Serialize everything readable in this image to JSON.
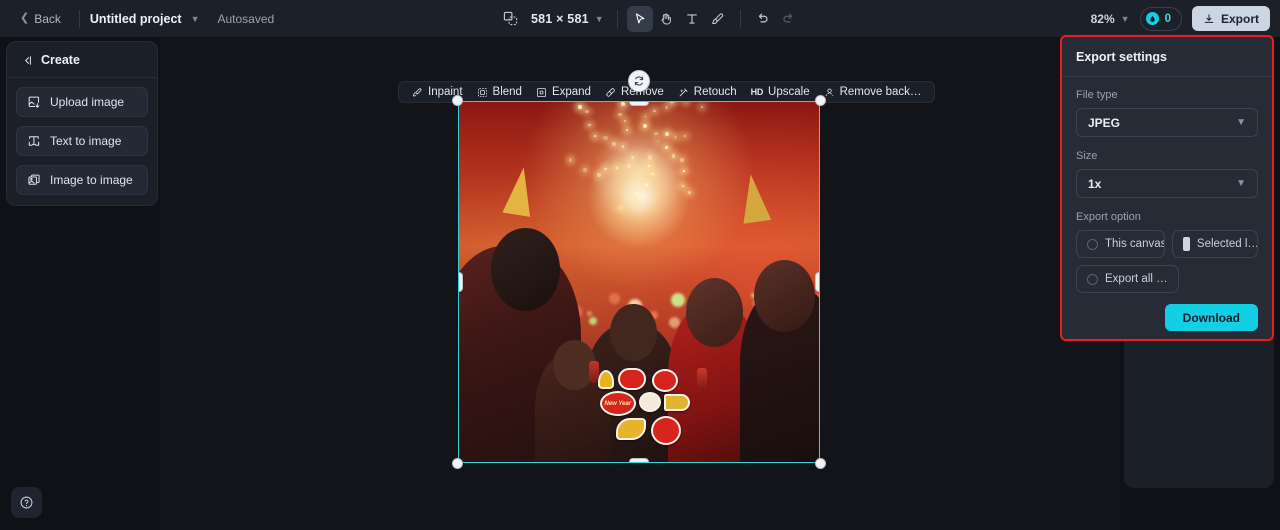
{
  "header": {
    "back_label": "Back",
    "project_name": "Untitled project",
    "autosave_status": "Autosaved",
    "canvas_size": "581 × 581",
    "zoom_level": "82%",
    "credits_count": "0",
    "export_label": "Export",
    "tools": [
      {
        "name": "canvas-size-icon",
        "label": ""
      },
      {
        "name": "select-tool",
        "label": "",
        "active": true
      },
      {
        "name": "hand-tool",
        "label": "",
        "active": false
      },
      {
        "name": "text-tool",
        "label": "",
        "active": false
      },
      {
        "name": "brush-tool",
        "label": "",
        "active": false
      },
      {
        "name": "undo",
        "label": "",
        "active": false
      },
      {
        "name": "redo",
        "label": "",
        "active": false
      }
    ]
  },
  "sidebar": {
    "title": "Create",
    "items": [
      {
        "label": "Upload image",
        "icon": "upload-image-icon"
      },
      {
        "label": "Text to image",
        "icon": "text-to-image-icon"
      },
      {
        "label": "Image to image",
        "icon": "image-to-image-icon"
      }
    ]
  },
  "canvas_toolbar": {
    "items": [
      {
        "label": "Inpaint",
        "icon": "inpaint-icon"
      },
      {
        "label": "Blend",
        "icon": "blend-icon"
      },
      {
        "label": "Expand",
        "icon": "expand-icon"
      },
      {
        "label": "Remove",
        "icon": "remove-icon"
      },
      {
        "label": "Retouch",
        "icon": "retouch-icon"
      },
      {
        "label": "Upscale",
        "icon": "hd-upscale-icon",
        "badge": "HD"
      },
      {
        "label": "Remove back…",
        "icon": "remove-background-icon"
      }
    ]
  },
  "export_panel": {
    "title": "Export settings",
    "file_type_label": "File type",
    "file_type_value": "JPEG",
    "size_label": "Size",
    "size_value": "1x",
    "export_option_label": "Export option",
    "options": [
      {
        "label": "This canvas",
        "selected": false
      },
      {
        "label": "Selected l…",
        "selected": true
      },
      {
        "label": "Export all …",
        "selected": false
      }
    ],
    "download_label": "Download",
    "accent_color": "#13cfe3",
    "highlight_color": "#ee1c20"
  },
  "artwork": {
    "description": "New Year party photo with fireworks and people in gold party hats",
    "sticker_text": "New Year"
  },
  "help": {
    "icon": "help-icon"
  }
}
